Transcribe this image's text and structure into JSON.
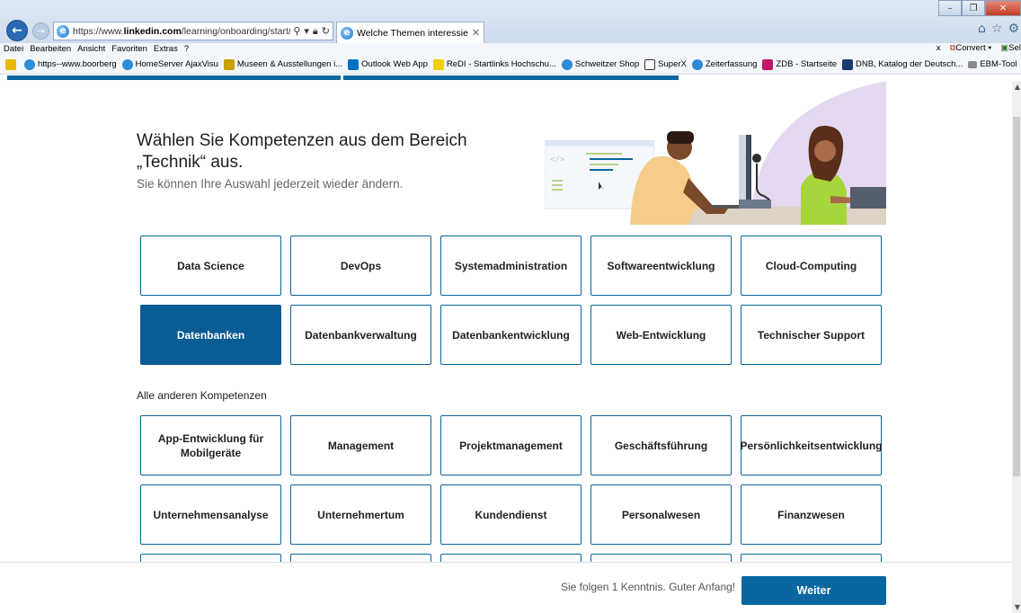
{
  "browser": {
    "url_prefix": "https://www.",
    "url_domain": "linkedin.com",
    "url_rest": "/learning/onboarding/start/intere",
    "tab_title": "Welche Themen interessier...",
    "menu": [
      "Datei",
      "Bearbeiten",
      "Ansicht",
      "Favoriten",
      "Extras",
      "?"
    ],
    "menu_right": {
      "close": "x",
      "convert": "Convert",
      "select": "Sel"
    },
    "favorites": [
      "https--www.boorberg",
      "HomeServer AjaxVisu",
      "Museen & Ausstellungen i...",
      "Outlook Web App",
      "ReDI - Startlinks Hochschu...",
      "Schweitzer Shop",
      "SuperX",
      "Zeiterfassung",
      "ZDB - Startseite",
      "DNB, Katalog der Deutsch...",
      "EBM-Tool"
    ],
    "fav_colors": [
      "#e8b800",
      "#2e8bd6",
      "#2e8bd6",
      "#c8a000",
      "#0072c6",
      "#f0d000",
      "#2e8bd6",
      "#333333",
      "#2e8bd6",
      "#c0186a",
      "#1d3a6e",
      "#888888"
    ]
  },
  "page": {
    "heading": "Wählen Sie Kompetenzen aus dem Bereich „Technik“ aus.",
    "subheading": "Sie können Ihre Auswahl jederzeit wieder ändern.",
    "tech_skills": [
      "Data Science",
      "DevOps",
      "Systemadministration",
      "Softwareentwicklung",
      "Cloud-Computing",
      "Datenbanken",
      "Datenbankverwaltung",
      "Datenbankentwicklung",
      "Web-Entwicklung",
      "Technischer Support"
    ],
    "selected_skill": "Datenbanken",
    "other_label": "Alle anderen Kompetenzen",
    "other_skills": [
      "App-Entwicklung für Mobilgeräte",
      "Management",
      "Projektmanagement",
      "Geschäftsführung",
      "Persönlichkeitsentwicklung",
      "Unternehmensanalyse",
      "Unternehmertum",
      "Kundendienst",
      "Personalwesen",
      "Finanzwesen"
    ],
    "accent_color": "#0a66a0"
  },
  "footer": {
    "status": "Sie folgen 1 Kenntnis. Guter Anfang!",
    "next_label": "Weiter"
  }
}
